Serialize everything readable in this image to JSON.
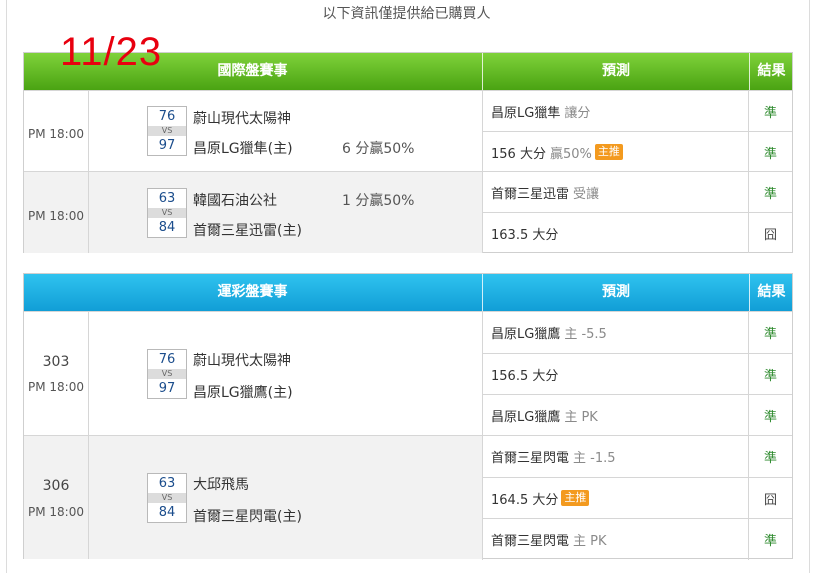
{
  "notice": "以下資訊僅提供給已購買人",
  "date_stamp": "11/23",
  "headers": {
    "event1": "國際盤賽事",
    "event2": "運彩盤賽事",
    "prediction": "預測",
    "result": "結果"
  },
  "badge_label": "主推",
  "intl_matches": [
    {
      "time": "PM 18:00",
      "score_away": "76",
      "score_home": "97",
      "vs": "VS",
      "team_away": "蔚山現代太陽神",
      "team_home": "昌原LG獵隼(主)",
      "handicap": "6 分贏50%",
      "handicap_row": "home",
      "preds": [
        {
          "main": "昌原LG獵隼",
          "note": "讓分",
          "badge": false,
          "result": "準"
        },
        {
          "main": "156 大分",
          "note": "贏50%",
          "badge": true,
          "result": "準"
        }
      ]
    },
    {
      "time": "PM 18:00",
      "score_away": "63",
      "score_home": "84",
      "vs": "VS",
      "team_away": "韓國石油公社",
      "team_home": "首爾三星迅雷(主)",
      "handicap": "1 分贏50%",
      "handicap_row": "away",
      "preds": [
        {
          "main": "首爾三星迅雷",
          "note": "受讓",
          "badge": false,
          "result": "準"
        },
        {
          "main": "163.5 大分",
          "note": "",
          "badge": false,
          "result": "囧"
        }
      ]
    }
  ],
  "lottery_matches": [
    {
      "code": "303",
      "time": "PM 18:00",
      "score_away": "76",
      "score_home": "97",
      "vs": "VS",
      "team_away": "蔚山現代太陽神",
      "team_home": "昌原LG獵鷹(主)",
      "preds": [
        {
          "main": "昌原LG獵鷹",
          "note": "主 -5.5",
          "badge": false,
          "result": "準"
        },
        {
          "main": "156.5 大分",
          "note": "",
          "badge": false,
          "result": "準"
        },
        {
          "main": "昌原LG獵鷹",
          "note": "主 PK",
          "badge": false,
          "result": "準"
        }
      ]
    },
    {
      "code": "306",
      "time": "PM 18:00",
      "score_away": "63",
      "score_home": "84",
      "vs": "VS",
      "team_away": "大邱飛馬",
      "team_home": "首爾三星閃電(主)",
      "preds": [
        {
          "main": "首爾三星閃電",
          "note": "主 -1.5",
          "badge": false,
          "result": "準"
        },
        {
          "main": "164.5 大分",
          "note": "",
          "badge": true,
          "result": "囧"
        },
        {
          "main": "首爾三星閃電",
          "note": "主 PK",
          "badge": false,
          "result": "準"
        }
      ]
    }
  ]
}
